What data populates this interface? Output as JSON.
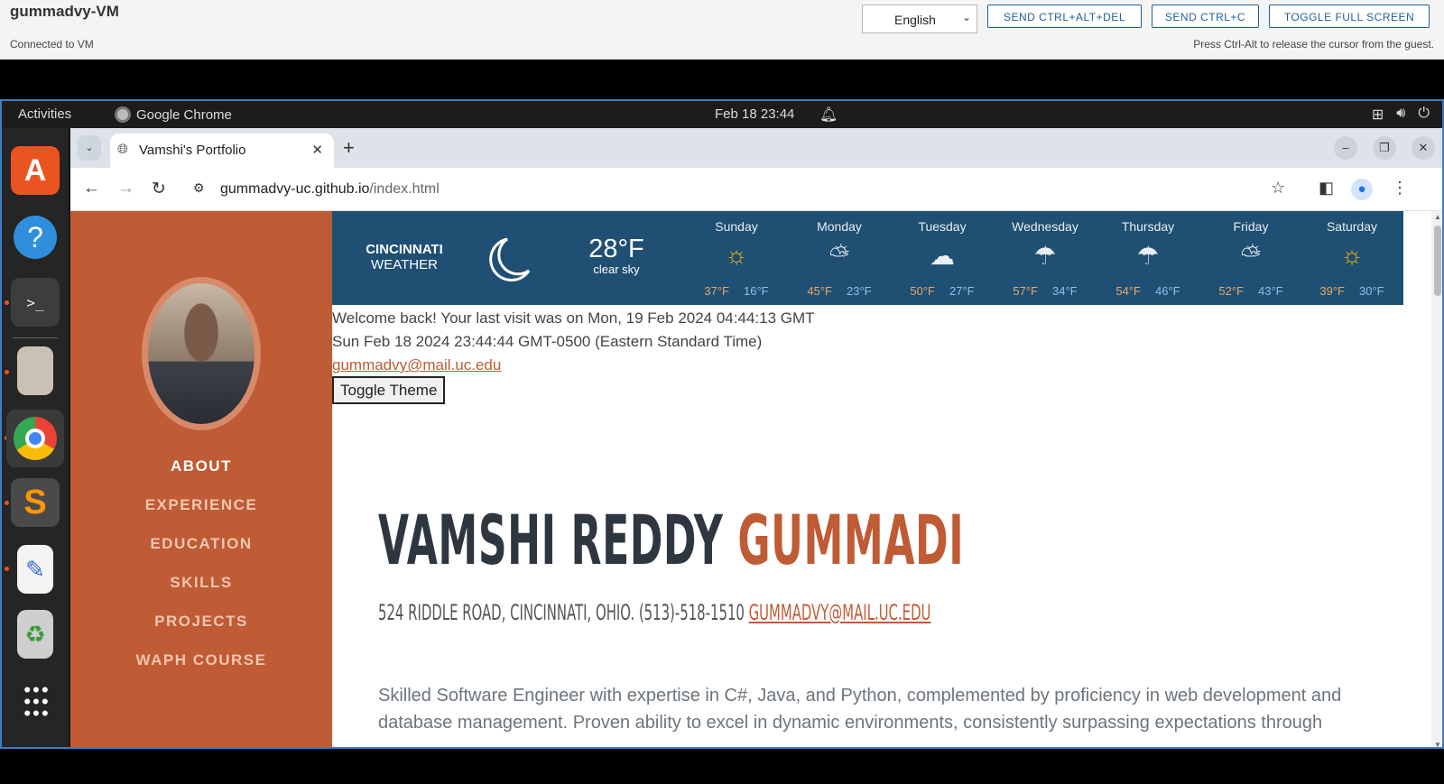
{
  "vm": {
    "title": "gummadvy-VM",
    "status": "Connected to VM",
    "language": "English",
    "buttons": [
      "SEND CTRL+ALT+DEL",
      "SEND CTRL+C",
      "TOGGLE FULL SCREEN"
    ],
    "hint": "Press Ctrl-Alt to release the cursor from the guest."
  },
  "ubuntu": {
    "activities": "Activities",
    "app": "Google Chrome",
    "clock": "Feb 18  23:44"
  },
  "dock": [
    "app-center",
    "help",
    "terminal",
    "archive-manager",
    "chrome",
    "sublime-text",
    "text-editor",
    "trash",
    "show-apps"
  ],
  "browser": {
    "tab_title": "Vamshi's Portfolio",
    "url_domain": "gummadvy-uc.github.io",
    "url_path": "/index.html"
  },
  "sidebar": {
    "items": [
      "ABOUT",
      "EXPERIENCE",
      "EDUCATION",
      "SKILLS",
      "PROJECTS",
      "WAPH COURSE"
    ]
  },
  "weather": {
    "city": "CINCINNATI",
    "label": "WEATHER",
    "temp": "28°F",
    "desc": "clear sky",
    "days": [
      {
        "name": "Sunday",
        "icon": "sun",
        "hi": "37°F",
        "lo": "16°F"
      },
      {
        "name": "Monday",
        "icon": "partly-cloudy",
        "hi": "45°F",
        "lo": "23°F"
      },
      {
        "name": "Tuesday",
        "icon": "cloud",
        "hi": "50°F",
        "lo": "27°F"
      },
      {
        "name": "Wednesday",
        "icon": "rain-cloud",
        "hi": "57°F",
        "lo": "34°F"
      },
      {
        "name": "Thursday",
        "icon": "rain-cloud",
        "hi": "54°F",
        "lo": "46°F"
      },
      {
        "name": "Friday",
        "icon": "partly-cloudy",
        "hi": "52°F",
        "lo": "43°F"
      },
      {
        "name": "Saturday",
        "icon": "sun",
        "hi": "39°F",
        "lo": "30°F"
      }
    ]
  },
  "content": {
    "welcome": "Welcome back! Your last visit was on Mon, 19 Feb 2024 04:44:13 GMT",
    "date": "Sun Feb 18 2024 23:44:44 GMT-0500 (Eastern Standard Time)",
    "email": "gummadvy@mail.uc.edu",
    "toggle": "Toggle Theme",
    "first_name": "VAMSHI REDDY",
    "last_name": "GUMMADI",
    "address": "524 RIDDLE ROAD, CINCINNATI, OHIO. (513)-518-1510",
    "address_email": "GUMMADVY@MAIL.UC.EDU",
    "bio": "Skilled Software Engineer with expertise in C#, Java, and Python, complemented by proficiency in web development and database management. Proven ability to excel in dynamic environments, consistently surpassing expectations through"
  }
}
